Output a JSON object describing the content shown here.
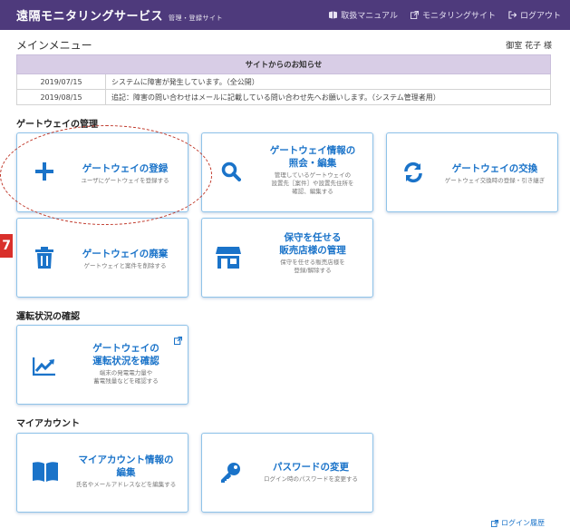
{
  "header": {
    "title": "遠隔モニタリングサービス",
    "subtitle": "管理・登録サイト",
    "nav": [
      {
        "label": "取扱マニュアル",
        "icon": "book-icon"
      },
      {
        "label": "モニタリングサイト",
        "icon": "external-link-icon"
      },
      {
        "label": "ログアウト",
        "icon": "logout-icon"
      }
    ]
  },
  "main": {
    "title": "メインメニュー",
    "user": "御室 花子 様"
  },
  "notices": {
    "heading": "サイトからのお知らせ",
    "rows": [
      {
        "date": "2019/07/15",
        "text": "システムに障害が発生しています。（全公開）"
      },
      {
        "date": "2019/08/15",
        "text": "追記：障害の問い合わせはメールに記載している問い合わせ先へお願いします。（システム管理者用）"
      }
    ]
  },
  "sections": {
    "gateway": "ゲートウェイの管理",
    "status": "運転状況の確認",
    "account": "マイアカウント"
  },
  "cards": {
    "register": {
      "title": "ゲートウェイの登録",
      "desc": "ユーザにゲートウェイを登録する"
    },
    "inquiry": {
      "title1": "ゲートウェイ情報の",
      "title2": "照会・編集",
      "desc1": "管理しているゲートウェイの",
      "desc2": "設置先［案件］や設置先住所を",
      "desc3": "確認、編集する"
    },
    "exchange": {
      "title": "ゲートウェイの交換",
      "desc": "ゲートウェイ交換時の登録・引き継ぎ"
    },
    "discard": {
      "title": "ゲートウェイの廃棄",
      "desc": "ゲートウェイと案件を削除する"
    },
    "store": {
      "title1": "保守を任せる",
      "title2": "販売店様の管理",
      "desc1": "保守を任せる販売店様を",
      "desc2": "登録/解除する"
    },
    "operation": {
      "title1": "ゲートウェイの",
      "title2": "運転状況を確認",
      "desc1": "端末の発電電力量や",
      "desc2": "蓄電残量などを確認する"
    },
    "account_info": {
      "title1": "マイアカウント情報の",
      "title2": "編集",
      "desc": "氏名やメールアドレスなどを編集する"
    },
    "password": {
      "title": "パスワードの変更",
      "desc": "ログイン時のパスワードを変更する"
    }
  },
  "marker": "7",
  "footer": {
    "login_history": "ログイン履歴"
  },
  "colors": {
    "header": "#4e3a7c",
    "accent": "#1a73c9",
    "marker": "#d9302b",
    "notice_head": "#d8cde6"
  }
}
